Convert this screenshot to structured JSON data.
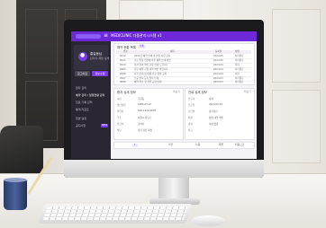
{
  "colors": {
    "accent": "#6d28d9",
    "sidebar": "#2a2733",
    "background": "#f4f4f6"
  },
  "app": {
    "menu_icon": "≡",
    "title": "MEDICLINIC 다중관리시스템 v1"
  },
  "sidebar": {
    "profile_name": "홍길동님",
    "profile_sub": "관리자 계정 상세",
    "btn_left": "로그아웃",
    "btn_right": "정보수정",
    "items": [
      {
        "label": "환자 관리"
      },
      {
        "label": "예약 관리 / 일정현황 관리"
      },
      {
        "label": "진료 기록 관리"
      },
      {
        "label": "통계 리포트"
      },
      {
        "label": "환경 설정"
      },
      {
        "label": "공지사항"
      }
    ],
    "badge": "NEW"
  },
  "main": {
    "card1": {
      "title": "예약 현황 목록",
      "tag": "전체",
      "columns": [
        "번호",
        "제목",
        "등록일",
        "상태"
      ],
      "rows": [
        [
          "0012",
          "2024년 예약 안내 및 변경 사항 공지",
          "2024.05",
          "처리완료"
        ],
        [
          "0011",
          "진료 일정 변경에 따른 예약 안내 확인",
          "2024.05",
          "처리완료"
        ],
        [
          "0010",
          "검사 결과 확인 요청 안내 드립니다",
          "2024.04",
          "대기"
        ],
        [
          "0009",
          "진료 예약 신청 내역 확인 바랍니다",
          "2024.04",
          "처리완료"
        ],
        [
          "0008",
          "휴진 안내 및 대체 진료 일정 공지",
          "2024.04",
          "대기"
        ],
        [
          "0007",
          "신규 환자 등록 절차 안내",
          "2024.03",
          "처리완료"
        ],
        [
          "0006",
          "예약 취소 및 환불 규정 안내",
          "2024.03",
          "처리완료"
        ]
      ]
    },
    "card2": {
      "title": "환자 상세 정보",
      "more": "더보기",
      "fields": [
        {
          "label": "이름",
          "value": "홍길동"
        },
        {
          "label": "생년월일",
          "value": "1985.03.12"
        },
        {
          "label": "연락처",
          "value": "010-1234-5678"
        },
        {
          "label": "주소",
          "value": "서울시 강남구"
        },
        {
          "label": "담당의",
          "value": "김의사"
        },
        {
          "label": "메모",
          "value": "정기 검진 대상"
        }
      ]
    },
    "card3": {
      "title": "진료 상세 정보",
      "more": "더보기",
      "fields": [
        {
          "label": "진료과",
          "value": "내과"
        },
        {
          "label": "진료일",
          "value": "2024.05.20"
        },
        {
          "label": "진단명",
          "value": "정기검진"
        },
        {
          "label": "처방",
          "value": "처방 내역 확인"
        },
        {
          "label": "결과",
          "value": "이상 없음"
        },
        {
          "label": "비고",
          "value": "-"
        }
      ]
    },
    "pager": {
      "tag": "1",
      "items": [
        "이전",
        "다음",
        "목록",
        "처음으로"
      ]
    }
  },
  "icons": {
    "avatar": "user-icon",
    "menu": "menu-icon"
  }
}
